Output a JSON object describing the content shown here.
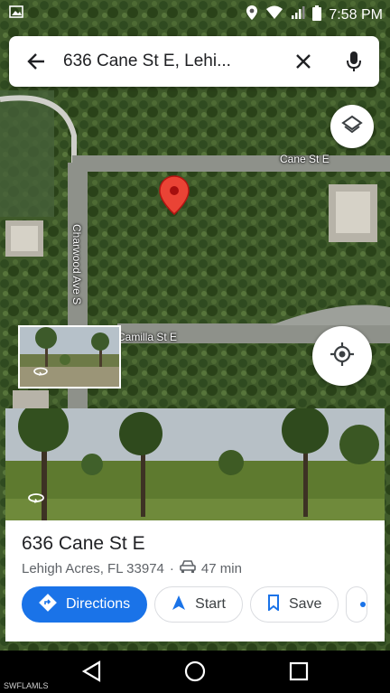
{
  "status_bar": {
    "time": "7:58 PM"
  },
  "search": {
    "query": "636 Cane St E, Lehi..."
  },
  "map": {
    "streets": [
      "Cane St E",
      "Charwood Ave S",
      "Camilla St E"
    ]
  },
  "place": {
    "title": "636 Cane St E",
    "address": "Lehigh Acres, FL 33974",
    "separator": "·",
    "drive_time": "47 min"
  },
  "actions": {
    "directions": "Directions",
    "start": "Start",
    "save": "Save"
  },
  "watermark": "SWFLAMLS",
  "colors": {
    "accent": "#1a73e8",
    "pin": "#ea4335"
  }
}
